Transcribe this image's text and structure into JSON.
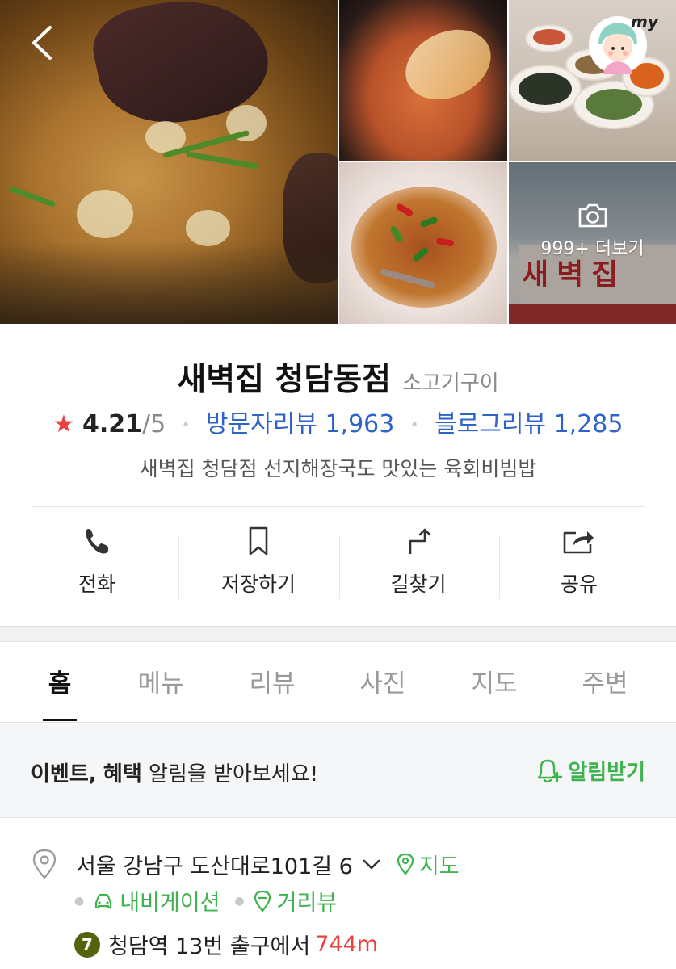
{
  "colors": {
    "accent_green": "#3fb34f",
    "review_blue": "#2e63c9",
    "star_red": "#e8433e",
    "subway_line7": "#54640d"
  },
  "header": {
    "back_icon": "chevron-left-icon",
    "profile_label": "my"
  },
  "gallery": {
    "more_label": "999+ 더보기",
    "more_icon": "camera-icon",
    "sign_text": "새벽집"
  },
  "place": {
    "name": "새벽집 청담동점",
    "category": "소고기구이",
    "rating_star": "★",
    "rating": "4.21",
    "rating_max": "/5",
    "visitor_reviews": "방문자리뷰 1,963",
    "blog_reviews": "블로그리뷰 1,285",
    "description": "새벽집 청담점 선지해장국도 맛있는 육회비빔밥"
  },
  "actions": [
    {
      "label": "전화",
      "icon": "phone-icon"
    },
    {
      "label": "저장하기",
      "icon": "bookmark-icon"
    },
    {
      "label": "길찾기",
      "icon": "directions-icon"
    },
    {
      "label": "공유",
      "icon": "share-icon"
    }
  ],
  "tabs": [
    {
      "label": "홈",
      "active": true
    },
    {
      "label": "메뉴"
    },
    {
      "label": "리뷰"
    },
    {
      "label": "사진"
    },
    {
      "label": "지도"
    },
    {
      "label": "주변"
    }
  ],
  "notice": {
    "bold1": "이벤트,",
    "bold2": "혜택",
    "rest": "알림을 받아보세요!",
    "button": "알림받기"
  },
  "address": {
    "text": "서울 강남구 도산대로101길 6",
    "map_link": "지도",
    "navigation_link": "내비게이션",
    "street_view_link": "거리뷰",
    "subway_line": "7",
    "station_text": "청담역 13번 출구에서",
    "distance": "744m"
  }
}
